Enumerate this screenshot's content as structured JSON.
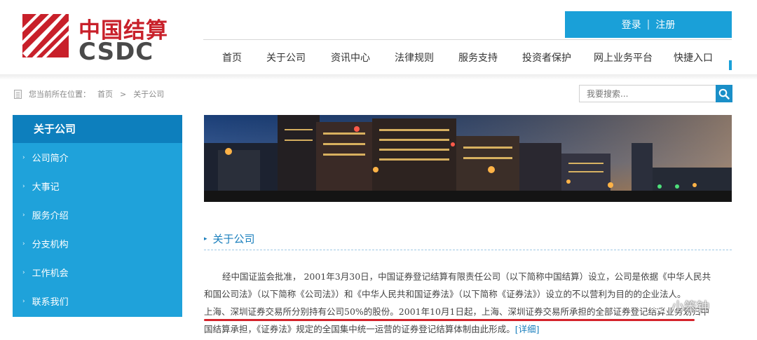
{
  "logo": {
    "cn": "中国结算",
    "en": "CSDC"
  },
  "auth": {
    "login": "登录",
    "separator": "|",
    "register": "注册"
  },
  "nav": {
    "items": [
      "首页",
      "关于公司",
      "资讯中心",
      "法律规则",
      "服务支持",
      "投资者保护",
      "网上业务平台",
      "快捷入口"
    ],
    "active_index": 1
  },
  "breadcrumb": {
    "prefix": "您当前所在位置：",
    "home": "首页",
    "sep": ">",
    "current": "关于公司"
  },
  "search": {
    "placeholder": "我要搜索..."
  },
  "sidebar": {
    "title": "关于公司",
    "items": [
      {
        "label": "公司简介"
      },
      {
        "label": "大事记"
      },
      {
        "label": "服务介绍"
      },
      {
        "label": "分支机构"
      },
      {
        "label": "工作机会"
      },
      {
        "label": "联系我们"
      }
    ]
  },
  "section": {
    "title": "关于公司"
  },
  "content": {
    "para_line1": "经中国证监会批准， 2001年3月30日，中国证券登记结算有限责任公司（以下简称中国结算）设立，公司是依据《中华人民共",
    "para_line2": "和国公司法》（以下简称《公司法》）和《中华人民共和国证券法》（以下简称《证券法》）设立的不以营利为目的的企业法人。",
    "para_line3": "上海、深圳证券交易所分别持有公司50%的股份。2001年10月1日起，上海、深圳证券交易所承担的全部证券登记结算业务划归中",
    "para_line4_text": "国结算承担，《证券法》规定的全国集中统一运营的证券登记结算体制由此形成。",
    "more": "[详细]"
  },
  "watermark": {
    "text": "小笨钟"
  },
  "colors": {
    "brand_red": "#c8202a",
    "accent_blue": "#1aa0d8",
    "sidebar_dark": "#0d7fbd",
    "sidebar_light": "#1fa2da"
  }
}
